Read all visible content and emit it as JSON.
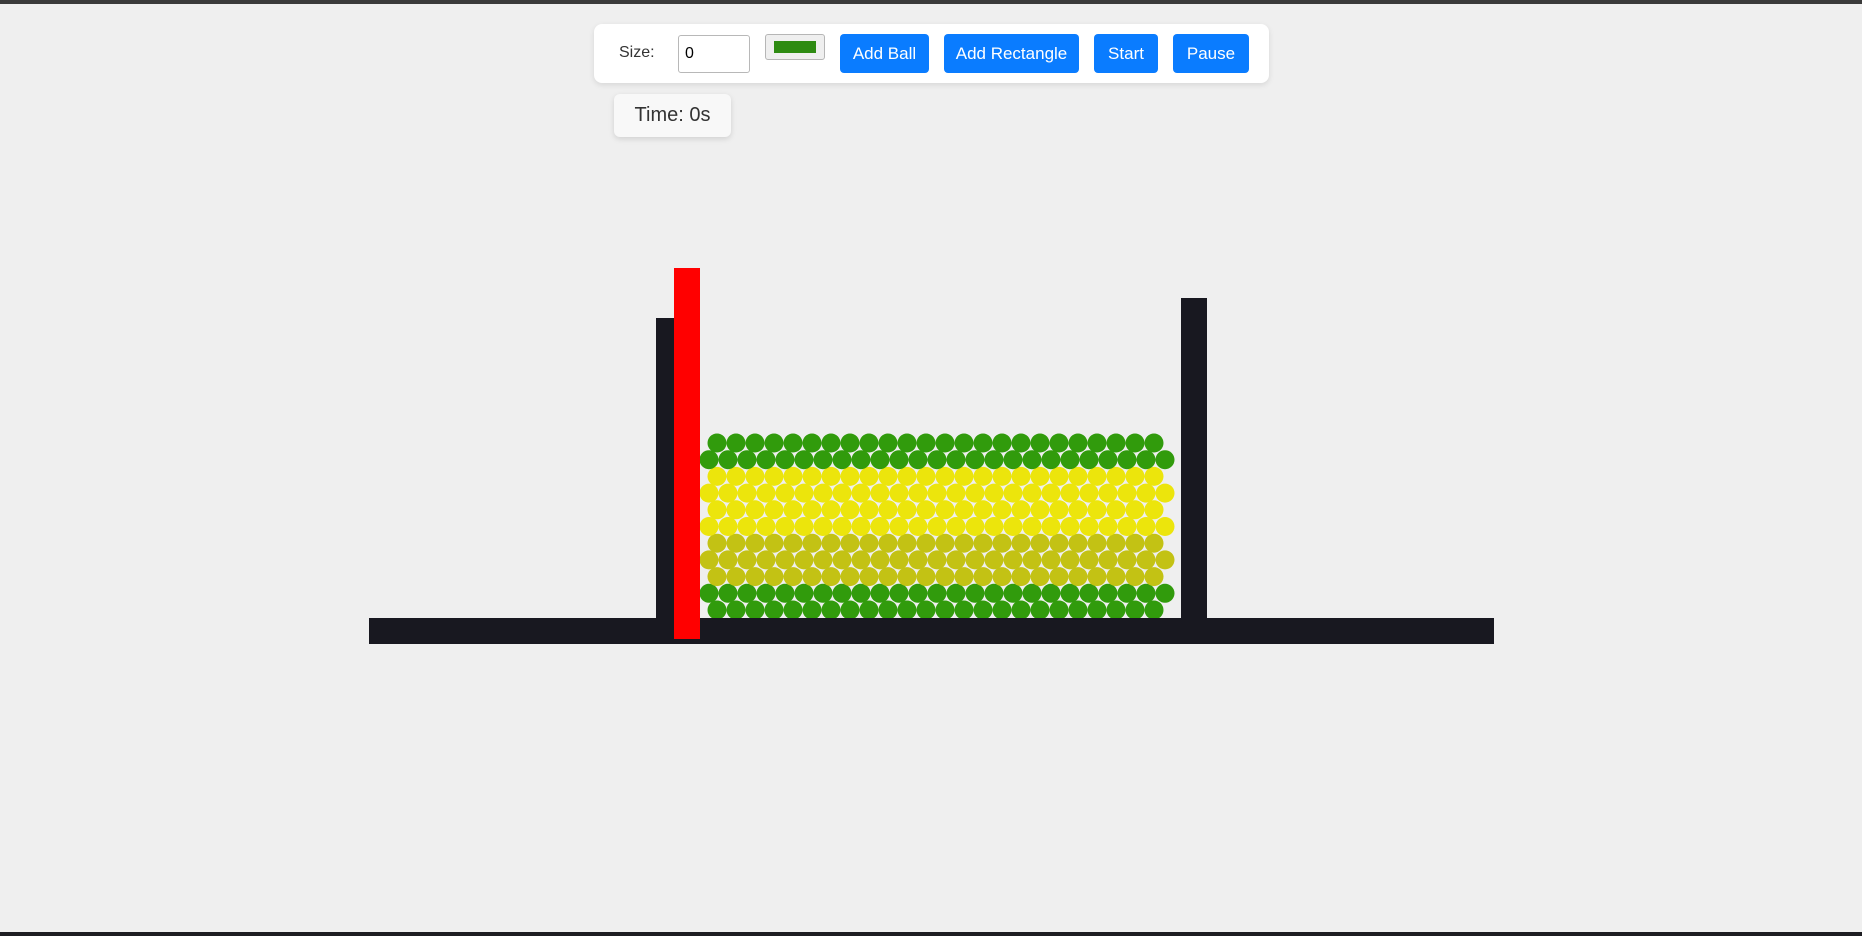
{
  "toolbar": {
    "size_label": "Size:",
    "size_value": "0",
    "color_value": "#2e8b12",
    "add_ball_label": "Add Ball",
    "add_rectangle_label": "Add Rectangle",
    "start_label": "Start",
    "pause_label": "Pause"
  },
  "status": {
    "time_text": "Time: 0s"
  },
  "colors": {
    "wall": "#181820",
    "gate": "#ff0000",
    "ball_green": "#319b0c",
    "ball_yellow": "#ece50c",
    "ball_olive": "#c3c214",
    "background": "#efefef",
    "button": "#0a7cff"
  },
  "scene": {
    "ball_layers": [
      {
        "name": "green-top",
        "color": "#319b0c",
        "rows": 2
      },
      {
        "name": "yellow",
        "color": "#ece50c",
        "rows": 4
      },
      {
        "name": "olive",
        "color": "#c3c214",
        "rows": 3
      },
      {
        "name": "green-bottom",
        "color": "#319b0c",
        "rows": 2
      }
    ]
  }
}
